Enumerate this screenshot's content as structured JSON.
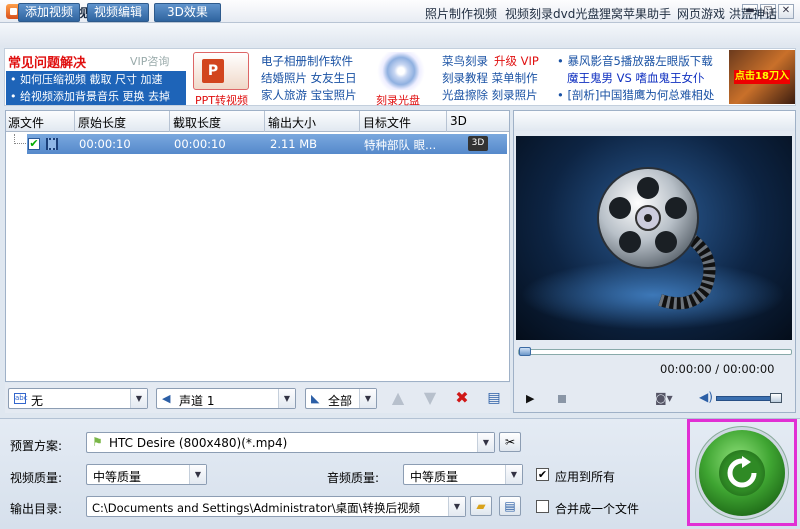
{
  "window": {
    "title": "狸窝全能视频转换器",
    "min_icon": "minimize-icon",
    "max_icon": "restore-icon",
    "close_icon": "close-icon"
  },
  "toolbar": {
    "buttons": [
      "添加视频",
      "视频编辑",
      "3D效果"
    ],
    "links": [
      "照片制作视频",
      "视频刻录dvd光盘",
      "狸窝苹果助手",
      "网页游戏 洪荒神话"
    ]
  },
  "ads": {
    "faq_title": "常见问题解决",
    "vip_label": "VIP咨询",
    "faq_rows": [
      "• 如何压缩视频  截取  尺寸  加速",
      "• 给视频添加背景音乐  更换  去掉"
    ],
    "ppt_caption": "PPT转视频",
    "album_links": [
      "电子相册制作软件",
      "结婚照片  女友生日",
      "家人旅游  宝宝照片"
    ],
    "burn_caption": "刻录光盘",
    "burn_links": [
      "菜鸟刻录",
      "升级 VIP",
      "刻录教程  菜单制作",
      "光盘擦除  刻录照片"
    ],
    "news_links": [
      "• 暴风影音5播放器左眼版下载",
      "魔王鬼男 VS 嗜血鬼王女仆",
      "• [剖析]中国猎鹰为何总难相处"
    ],
    "game_tag": "点击18刀入"
  },
  "file_list": {
    "columns": [
      "源文件",
      "原始长度",
      "截取长度",
      "输出大小",
      "目标文件",
      "3D"
    ],
    "rows": [
      {
        "checked": true,
        "original_length": "00:00:10",
        "clip_length": "00:00:10",
        "output_size": "2.11 MB",
        "target": "特种部队 眼...",
        "badge_3d": "3D"
      }
    ]
  },
  "list_controls": {
    "subtitle": "无",
    "audio_track": "声道 1",
    "audio_scope": "全部",
    "icons": [
      "move-up-icon",
      "move-down-icon",
      "delete-icon",
      "clear-list-icon"
    ]
  },
  "preview": {
    "timecode": "00:00:00 / 00:00:00",
    "seek_position": 0,
    "volume": 0.85,
    "icons": [
      "play-icon",
      "stop-icon",
      "snapshot-icon",
      "volume-icon"
    ]
  },
  "settings": {
    "preset_label": "预置方案:",
    "preset_value": "HTC Desire (800x480)(*.mp4)",
    "video_quality_label": "视频质量:",
    "video_quality_value": "中等质量",
    "audio_quality_label": "音频质量:",
    "audio_quality_value": "中等质量",
    "apply_all_label": "应用到所有",
    "apply_all_checked": true,
    "output_dir_label": "输出目录:",
    "output_dir_value": "C:\\Documents and Settings\\Administrator\\桌面\\转换后视频",
    "merge_label": "合并成一个文件",
    "merge_checked": false
  },
  "colors": {
    "accent": "#5589cb",
    "highlight_frame": "#e12fd4",
    "convert_green": "#3fa532"
  }
}
